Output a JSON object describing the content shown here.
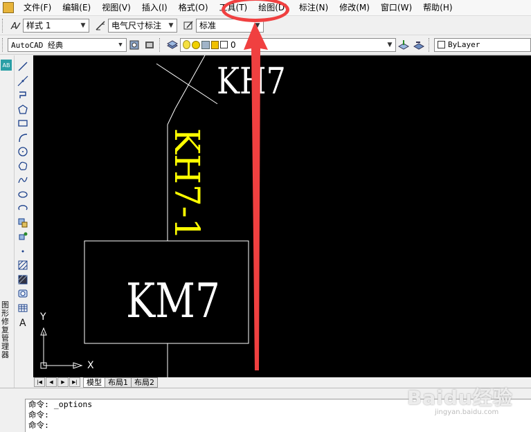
{
  "menu": {
    "items": [
      "文件(F)",
      "编辑(E)",
      "视图(V)",
      "插入(I)",
      "格式(O)",
      "工具(T)",
      "绘图(D)",
      "标注(N)",
      "修改(M)",
      "窗口(W)",
      "帮助(H)"
    ]
  },
  "toolbar1": {
    "text_style": "样式 1",
    "dim_style": "电气尺寸标注",
    "table_style": "标准"
  },
  "toolbar2": {
    "workspace": "AutoCAD 经典",
    "layer": "0",
    "color": "ByLayer"
  },
  "left_strip": {
    "label": "图形修复管理器"
  },
  "drawing": {
    "label_kh7": "KH7",
    "label_kh7_1": "KH7-1",
    "label_km7": "KM7",
    "axis_x": "X",
    "axis_y": "Y",
    "text_white": "#ffffff",
    "text_yellow": "#ffff00",
    "background": "#000000"
  },
  "tabs": [
    "模型",
    "布局1",
    "布局2"
  ],
  "command": {
    "lines": [
      "命令: _options",
      "命令:",
      "命令:"
    ]
  },
  "watermark": {
    "main": "Baidu经验",
    "sub": "jingyan.baidu.com"
  },
  "annotation": {
    "color": "#f04040"
  }
}
